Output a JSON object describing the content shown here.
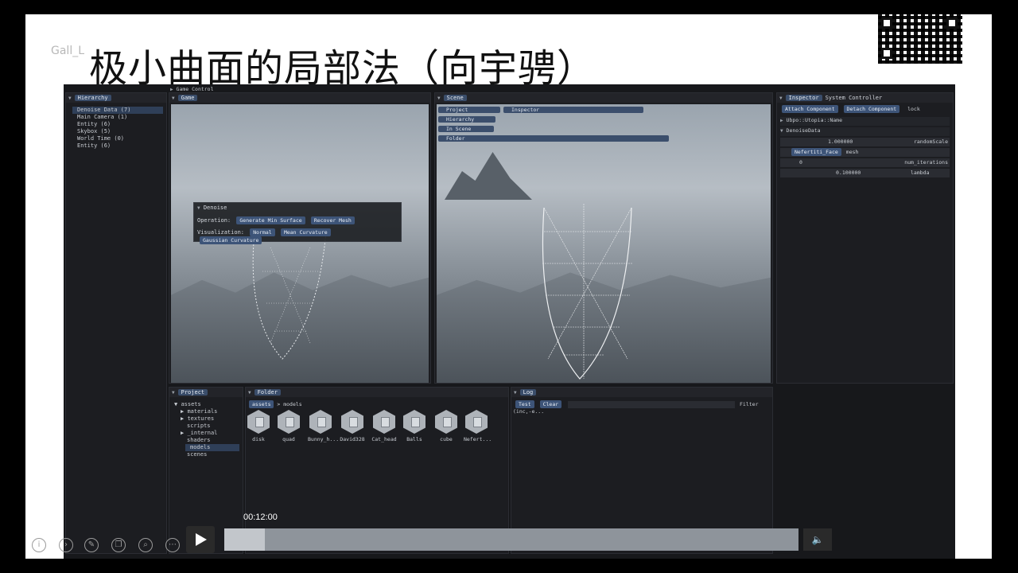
{
  "slide": {
    "title": "极小曲面的局部法（向宇骋）",
    "faint_text": "Gall_L"
  },
  "hierarchy": {
    "tab": "Hierarchy",
    "items": [
      "Denoise Data (7)",
      "Main Camera (1)",
      "Entity (6)",
      "Skybox (5)",
      "World Time (0)",
      "Entity (6)"
    ]
  },
  "game": {
    "header": "Game Control",
    "tab": "Game",
    "denoise_window": {
      "title": "Denoise",
      "operation_label": "Operation:",
      "operation_buttons": [
        "Generate Min Surface",
        "Recover Mesh"
      ],
      "visualization_label": "Visualization:",
      "visualization_buttons": [
        "Normal",
        "Mean Curvature",
        "Gaussian Curvature"
      ]
    }
  },
  "scene": {
    "tab": "Scene",
    "buttons": [
      "Project",
      "Inspector",
      "Hierarchy",
      "In Scene",
      "Folder"
    ]
  },
  "inspector": {
    "tabs": [
      "Inspector",
      "System Controller"
    ],
    "buttons": [
      "Attach Component",
      "Detach Component"
    ],
    "lock": "lock",
    "section1": "Ubpo::Utopia::Name",
    "section2": "DenoiseData",
    "fields": [
      {
        "value": "1.000000",
        "label": "randomScale"
      },
      {
        "value": "Nefertiti_Face",
        "label": "mesh"
      },
      {
        "value": "0",
        "label": "num_iterations"
      },
      {
        "value": "0.100000",
        "label": "lambda"
      }
    ]
  },
  "project": {
    "tab": "Project",
    "items": [
      "assets",
      "materials",
      "textures",
      "scripts",
      "_internal",
      "shaders",
      "models",
      "scenes"
    ]
  },
  "folder": {
    "tab": "Folder",
    "path_root": "assets",
    "path_child": "models",
    "assets": [
      "disk",
      "quad",
      "Bunny_h...",
      "David328",
      "Cat_head",
      "Balls",
      "cube",
      "Nefert..."
    ]
  },
  "log": {
    "tab": "Log",
    "buttons": [
      "Test",
      "Clear"
    ],
    "filter_label": "Filter (inc,-e..."
  },
  "player": {
    "time": "00:12:00",
    "progress": 0.07,
    "volume_icon": "speaker-icon"
  }
}
